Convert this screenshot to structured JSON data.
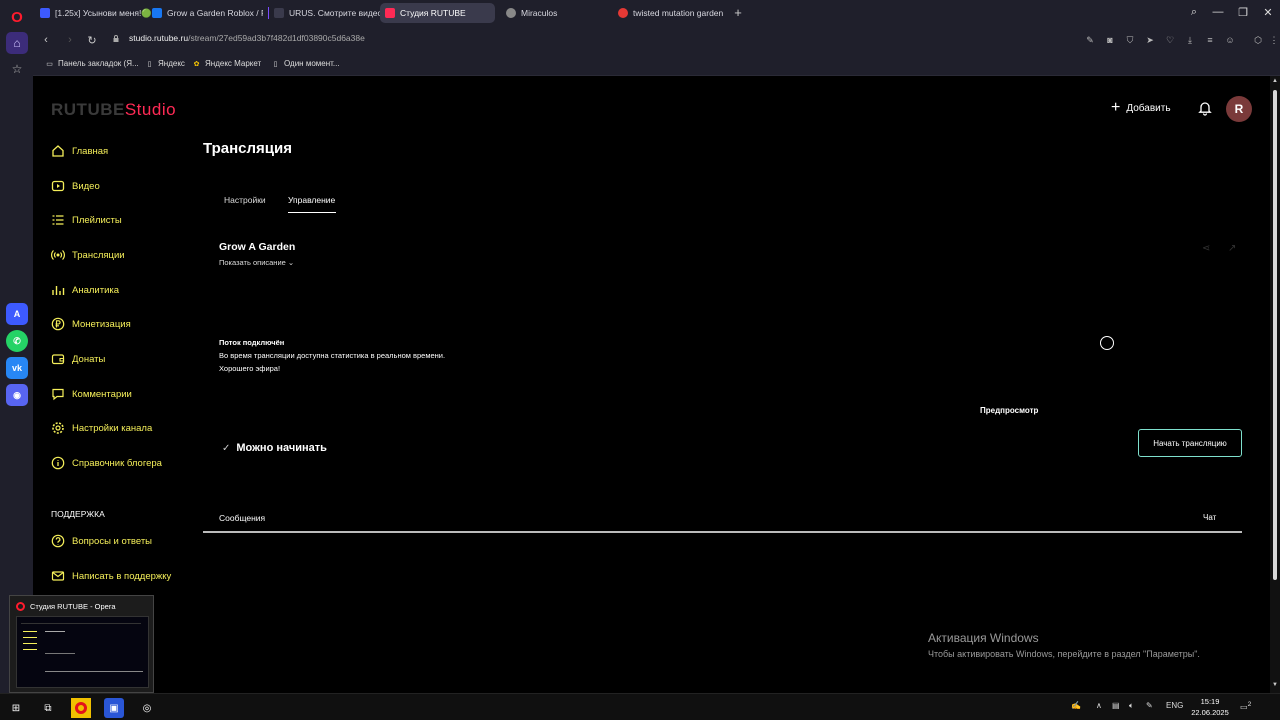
{
  "browser": {
    "tabs": [
      {
        "label": "[1.25x] Усынови меня!🟢",
        "favicon_color": "#3d5afe"
      },
      {
        "label": "Grow a Garden Roblox / F",
        "favicon_color": "#1877f2"
      },
      {
        "label": "URUS. Смотрите видео о",
        "favicon_color": "#3a3a4c"
      },
      {
        "label": "Студия RUTUBE",
        "favicon_color": "#ff2a55"
      },
      {
        "label": "Miraculos",
        "favicon_color": "#888888"
      },
      {
        "label": "twisted mutation garden",
        "favicon_color": "#e53935"
      }
    ],
    "url_host": "studio.rutube.ru",
    "url_path": "/stream/27ed59ad3b7f482d1df03890c5d6a38e",
    "bookmarks": [
      {
        "label": "Панель закладок (Я..."
      },
      {
        "label": "Яндекс"
      },
      {
        "label": "Яндекс Маркет"
      },
      {
        "label": "Один момент..."
      }
    ]
  },
  "brand": {
    "part1": "RUTUBE",
    "part2": "Studio"
  },
  "header": {
    "add_label": "Добавить",
    "avatar_letter": "R"
  },
  "sidebar": {
    "items": [
      {
        "label": "Главная",
        "icon": "home-icon"
      },
      {
        "label": "Видео",
        "icon": "video-icon"
      },
      {
        "label": "Плейлисты",
        "icon": "playlist-icon"
      },
      {
        "label": "Трансляции",
        "icon": "broadcast-icon"
      },
      {
        "label": "Аналитика",
        "icon": "analytics-icon"
      },
      {
        "label": "Монетизация",
        "icon": "ruble-icon"
      },
      {
        "label": "Донаты",
        "icon": "donate-icon"
      },
      {
        "label": "Комментарии",
        "icon": "comments-icon"
      },
      {
        "label": "Настройки канала",
        "icon": "gear-icon"
      },
      {
        "label": "Справочник блогера",
        "icon": "info-icon"
      }
    ],
    "support_title": "ПОДДЕРЖКА",
    "support_items": [
      {
        "label": "Вопросы и ответы",
        "icon": "question-icon"
      },
      {
        "label": "Написать в поддержку",
        "icon": "mail-icon"
      }
    ]
  },
  "main": {
    "title": "Трансляция",
    "tabs": [
      {
        "label": "Настройки"
      },
      {
        "label": "Управление"
      }
    ],
    "stream_title": "Grow A Garden",
    "show_description": "Показать описание",
    "status": {
      "title": "Поток подключён",
      "line1": "Во время трансляции доступна статистика в реальном времени.",
      "line2": "Хорошего эфира!"
    },
    "preview_label": "Предпросмотр",
    "ready_label": "Можно начинать",
    "start_button": "Начать трансляцию",
    "messages_tab": "Сообщения",
    "chat_tab": "Чат"
  },
  "watermark": {
    "title": "Активация Windows",
    "text": "Чтобы активировать Windows, перейдите в раздел \"Параметры\"."
  },
  "thumbnail": {
    "title": "Студия RUTUBE - Opera"
  },
  "taskbar": {
    "lang": "ENG",
    "time": "15:19",
    "date": "22.06.2025",
    "notifications": "2"
  },
  "colors": {
    "accent_yellow": "#f5ef5a",
    "brand_red": "#ff2a55",
    "start_border": "#7fe0cd"
  }
}
